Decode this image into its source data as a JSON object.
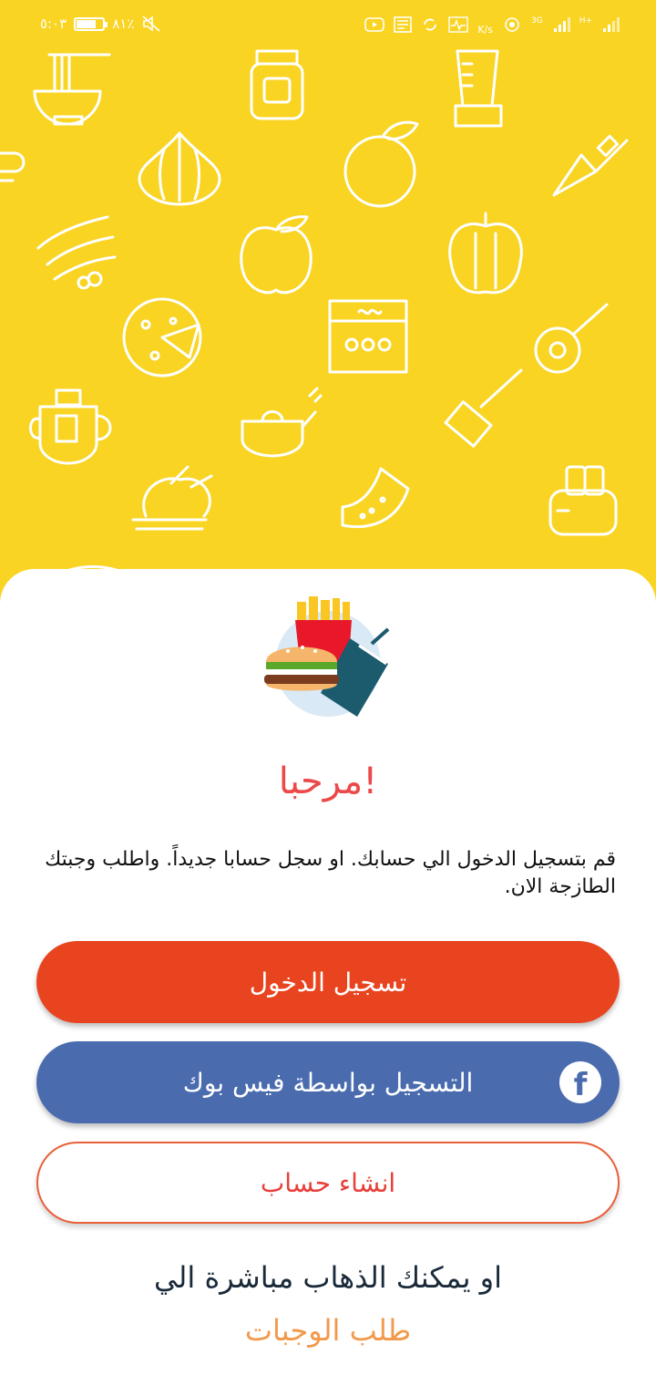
{
  "status_bar": {
    "time": "٥:٠٣",
    "battery": "٨١٪",
    "battery_level": 0.81,
    "network_speed": "K/s",
    "signal_left": "3G",
    "signal_right": "H+"
  },
  "welcome": {
    "title": "مرحبا!",
    "description": "قم بتسجيل الدخول الي حسابك. او سجل حسابا جديداً. واطلب وجبتك الطازجة الان."
  },
  "buttons": {
    "login": "تسجيل الدخول",
    "facebook": "التسجيل بواسطة فيس بوك",
    "create_account": "انشاء حساب"
  },
  "footer": {
    "or_text": "او يمكنك الذهاب مباشرة الي",
    "meals_link": "طلب الوجبات"
  },
  "colors": {
    "background": "#f9d423",
    "title": "#ec4a4a",
    "login": "#e8441f",
    "facebook": "#4a6cae",
    "link": "#f2994a"
  },
  "icons": {
    "facebook": "facebook-icon",
    "logo": "fast-food-logo-icon"
  }
}
